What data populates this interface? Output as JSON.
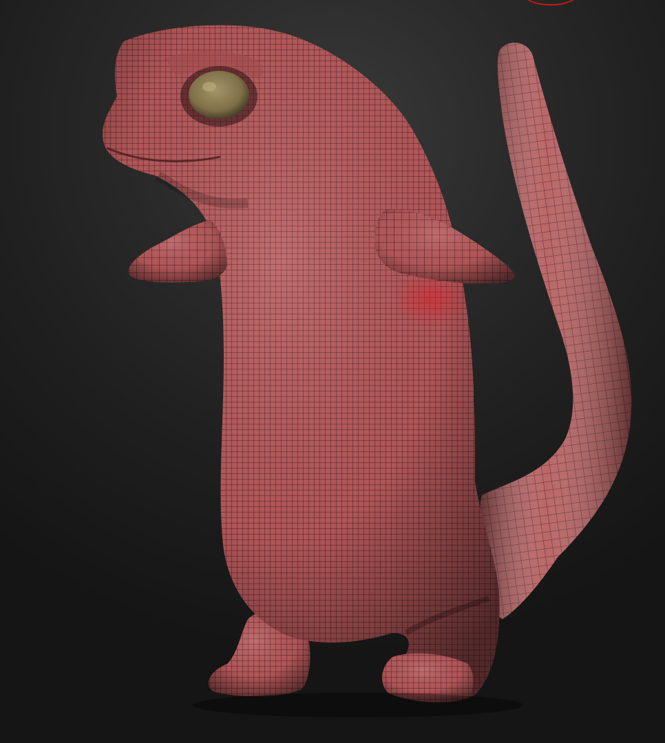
{
  "viewport": {
    "background_colors": [
      "#3a3a3a",
      "#2a2a2a",
      "#151515"
    ],
    "model": {
      "subject": "lizard-creature-mesh",
      "display_mode": "polyframe",
      "base_color": "#b85a5c",
      "wire_color": "#3a1518",
      "eye_color": "#8a7a52"
    },
    "gizmo": {
      "color": "#c81818"
    }
  }
}
